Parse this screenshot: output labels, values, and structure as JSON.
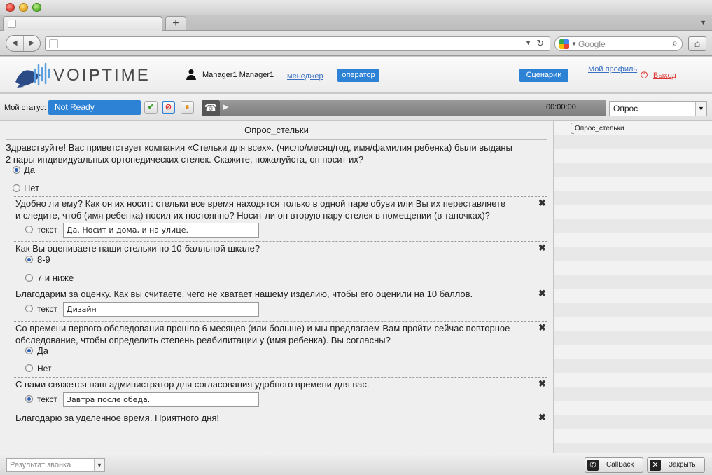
{
  "browser": {
    "search_placeholder": "Google"
  },
  "header": {
    "logo_prefix": "VO",
    "logo_mid": "IP",
    "logo_suffix": "TIME",
    "user_name": "Manager1 Manager1",
    "manager_link": "менеджер",
    "operator_button": "оператор",
    "scenarios_button": "Сценарии",
    "profile_link": "Мой профиль",
    "exit_link": "Выход"
  },
  "status": {
    "label": "Мой статус:",
    "value": "Not Ready",
    "call_timer": "00:00:00",
    "script_select": "Опрос"
  },
  "survey": {
    "title": "Опрос_стельки",
    "q1": {
      "text_line1": "Здравствуйте! Вас приветствует компания «Стельки для всех». (число/месяц/год, имя/фамилия ребенка) были выданы",
      "text_line2": "2 пары индивидуальных ортопедических стелек. Скажите, пожалуйста, он носит их?",
      "opt_yes": "Да",
      "opt_no": "Нет"
    },
    "q2": {
      "text_line1": "Удобно ли ему? Как он их носит: стельки все время находятся только в одной паре обуви или Вы их переставляете",
      "text_line2": "и следите, чтоб (имя ребенка) носил их постоянно? Носит ли он вторую пару стелек в помещении (в тапочках)?",
      "opt_label": "текст",
      "value": "Да. Носит и дома, и на улице."
    },
    "q3": {
      "text": "Как Вы оцениваете наши стельки по 10-балльной шкале?",
      "opt_a": "8-9",
      "opt_b": "7 и ниже"
    },
    "q4": {
      "text": "Благодарим за оценку. Как вы считаете, чего не хватает нашему изделию, чтобы его оценили на 10 баллов.",
      "opt_label": "текст",
      "value": "Дизайн"
    },
    "q5": {
      "text_line1": "Со времени первого обследования прошло 6 месяцев (или больше) и мы предлагаем Вам пройти сейчас повторное",
      "text_line2": "обследование, чтобы определить степень реабилитации у (имя ребенка). Вы согласны?",
      "opt_yes": "Да",
      "opt_no": "Нет"
    },
    "q6": {
      "text": "С вами свяжется наш администратор для согласования удобного времени для вас.",
      "opt_label": "текст",
      "value": "Завтра после обеда."
    },
    "q7": {
      "text": "Благодарю за уделенное время. Приятного дня!"
    }
  },
  "side_list": {
    "items": [
      {
        "label": "Опрос_стельки"
      }
    ]
  },
  "footer": {
    "result_placeholder": "Результат звонка",
    "callback_button": "CallBack",
    "close_button": "Закрыть"
  }
}
